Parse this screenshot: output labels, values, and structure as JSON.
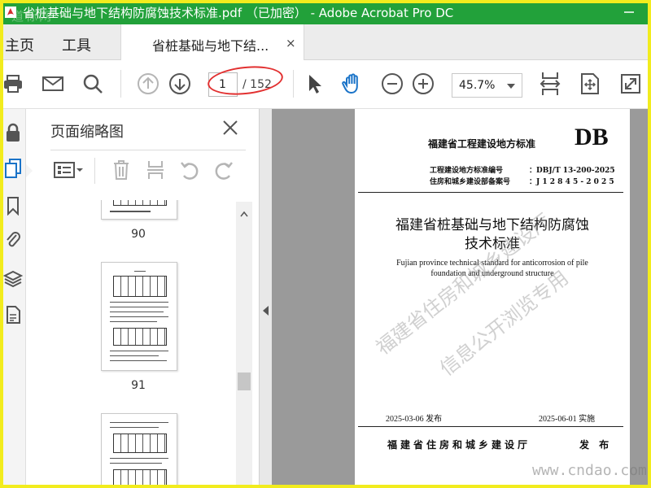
{
  "window": {
    "title": "省桩基础与地下结构防腐蚀技术标准.pdf （已加密） - Adobe Acrobat Pro DC",
    "watermark_text": "道标网"
  },
  "tabs": {
    "home": "主页",
    "tools": "工具",
    "document": "省桩基础与地下结...",
    "close_symbol": "×"
  },
  "toolbar": {
    "page_current": "1",
    "page_total": "/ 152",
    "zoom": "45.7%"
  },
  "thumbnails_panel": {
    "title": "页面缩略图",
    "pages": [
      {
        "label": "90"
      },
      {
        "label": "91"
      },
      {
        "label": ""
      }
    ]
  },
  "document": {
    "header": "福建省工程建设地方标准",
    "db_mark": "DB",
    "standard_no_label": "工程建设地方标准编号",
    "standard_no_value": "：DBJ/T 13-200-2025",
    "record_no_label": "住房和城乡建设部备案号",
    "record_no_value": "：J 1 2 8 4 5 - 2 0 2 5",
    "title_line1": "福建省桩基础与地下结构防腐蚀",
    "title_line2": "技术标准",
    "english_line1": "Fujian province technical standard for anticorrosion of pile",
    "english_line2": "foundation and underground structure",
    "issue_date": "2025-03-06   发布",
    "effective_date": "2025-06-01   实施",
    "publisher": "福建省住房和城乡建设厅",
    "publish_tag": "发 布",
    "watermark_line1": "福建省住房和城乡建设厅",
    "watermark_line2": "信息公开浏览专用"
  },
  "site_watermark": "www.cndao.com",
  "colors": {
    "titlebar": "#22a13a",
    "frame": "#f2ec1d",
    "hand_tool": "#1a73c8",
    "annotation": "#e23030"
  }
}
